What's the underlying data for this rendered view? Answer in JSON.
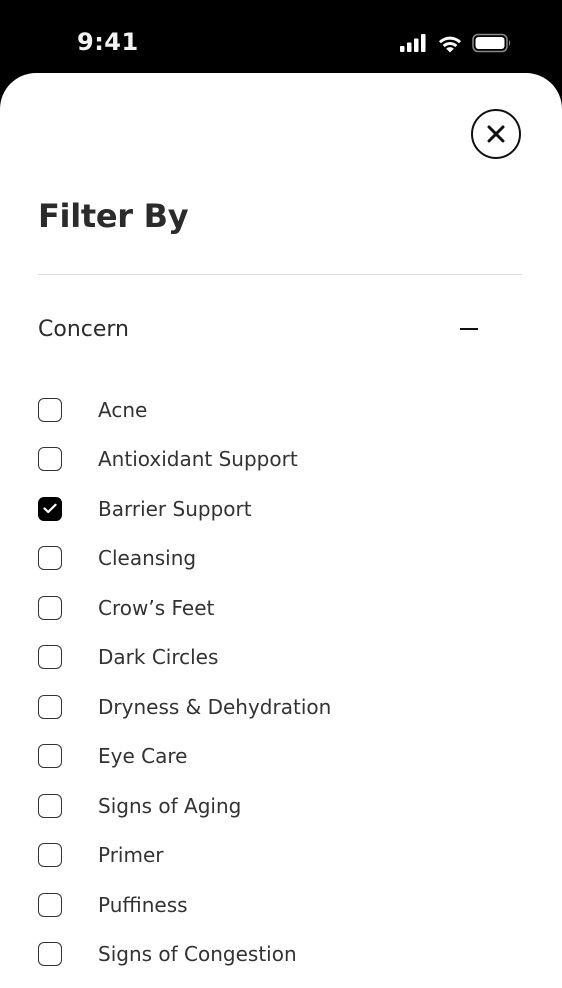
{
  "status_bar": {
    "time": "9:41",
    "icons": [
      "cellular-signal-icon",
      "wifi-icon",
      "battery-icon"
    ]
  },
  "filter": {
    "title": "Filter By",
    "close_icon": "close-icon",
    "section": {
      "title": "Concern",
      "toggle_icon": "minus-icon",
      "expanded": true,
      "options": [
        {
          "label": "Acne",
          "checked": false
        },
        {
          "label": "Antioxidant Support",
          "checked": false
        },
        {
          "label": "Barrier Support",
          "checked": true
        },
        {
          "label": "Cleansing",
          "checked": false
        },
        {
          "label": "Crow’s Feet",
          "checked": false
        },
        {
          "label": "Dark Circles",
          "checked": false
        },
        {
          "label": "Dryness & Dehydration",
          "checked": false
        },
        {
          "label": "Eye Care",
          "checked": false
        },
        {
          "label": "Signs of Aging",
          "checked": false
        },
        {
          "label": "Primer",
          "checked": false
        },
        {
          "label": "Puffiness",
          "checked": false
        },
        {
          "label": "Signs of Congestion",
          "checked": false
        }
      ]
    }
  },
  "colors": {
    "background": "#000000",
    "sheet": "#ffffff",
    "text": "#333333",
    "checked": "#000000"
  }
}
